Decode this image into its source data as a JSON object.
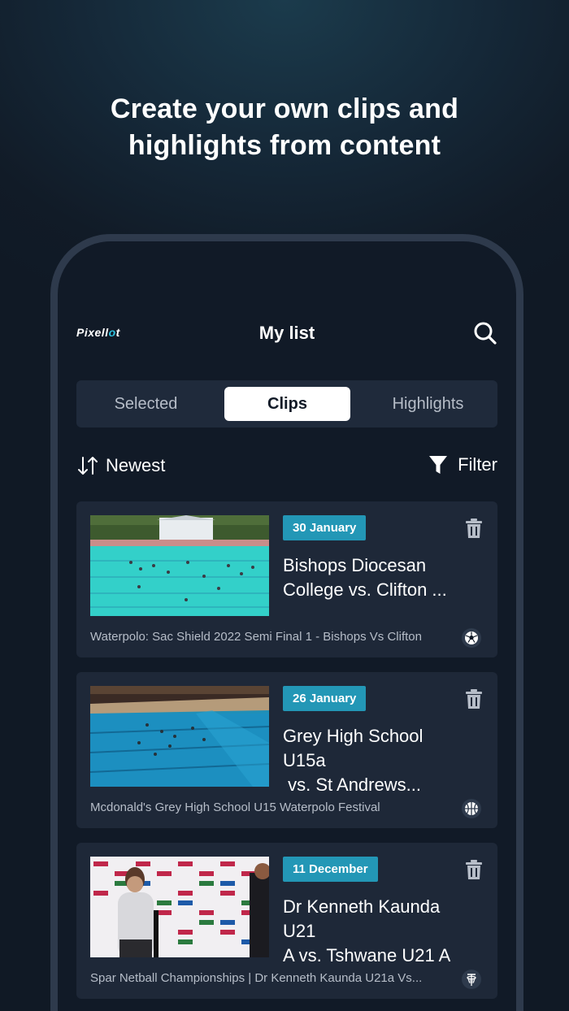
{
  "headline": {
    "line1": "Create your own clips and",
    "line2": "highlights from content"
  },
  "app": {
    "logo_prefix": "Pixell",
    "logo_o": "o",
    "logo_suffix": "t",
    "title": "My list",
    "search_icon": "search-icon"
  },
  "tabs": [
    {
      "label": "Selected",
      "active": false
    },
    {
      "label": "Clips",
      "active": true
    },
    {
      "label": "Highlights",
      "active": false
    }
  ],
  "sort": {
    "label": "Newest",
    "icon": "sort-arrows-icon"
  },
  "filter": {
    "label": "Filter",
    "icon": "funnel-icon"
  },
  "clips": [
    {
      "date": "30 January",
      "title_line1": "Bishops Diocesan",
      "title_line2": "College vs. Clifton ...",
      "subtitle": "Waterpolo: Sac Shield 2022 Semi Final 1 - Bishops Vs Clifton",
      "sport_icon": "soccer-ball-icon"
    },
    {
      "date": "26 January",
      "title_line1": "Grey High School U15a",
      "title_line2": " vs. St Andrews...",
      "subtitle": "Mcdonald's Grey High School U15 Waterpolo Festival",
      "sport_icon": "basketball-icon"
    },
    {
      "date": "11 December",
      "title_line1": "Dr Kenneth Kaunda U21",
      "title_line2": "A vs. Tshwane U21 A",
      "subtitle": "Spar Netball Championships | Dr Kenneth Kaunda U21a Vs...",
      "sport_icon": "netball-hoop-icon"
    }
  ],
  "colors": {
    "accent": "#2397b6",
    "card": "#1e2838",
    "background": "#111a27"
  }
}
